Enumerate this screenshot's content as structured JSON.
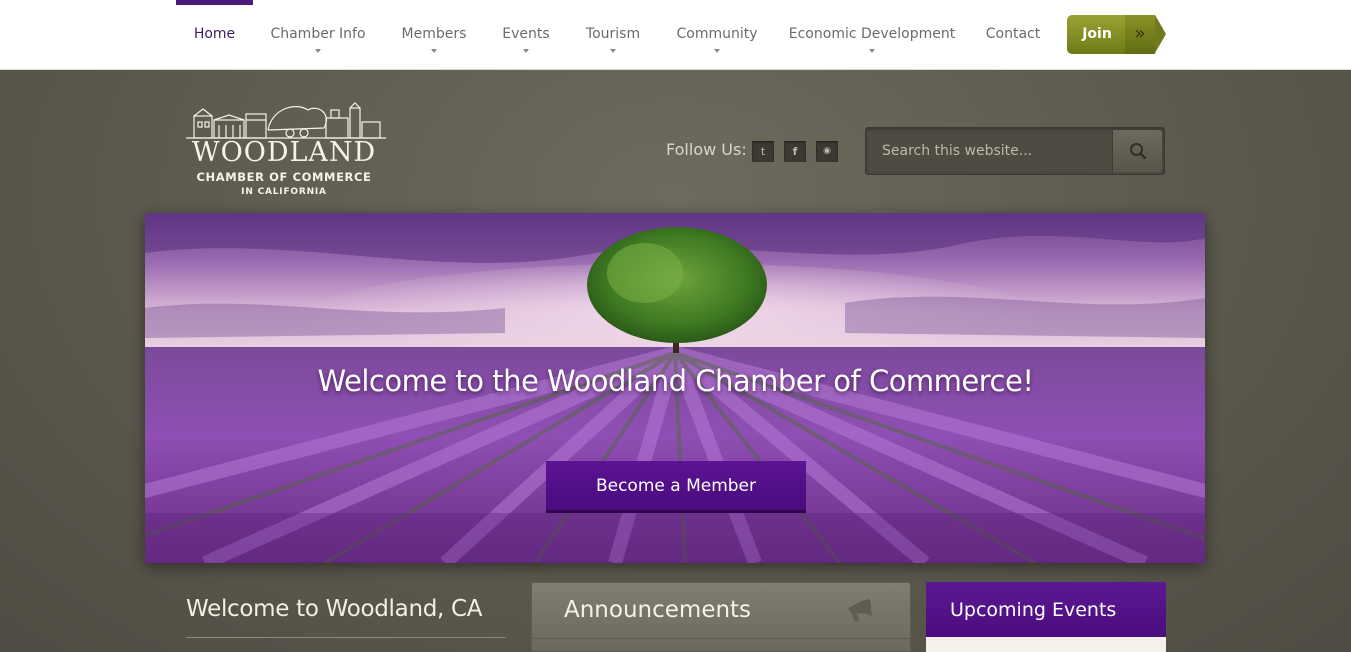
{
  "nav": {
    "items": [
      {
        "label": "Home",
        "active": true,
        "dropdown": false
      },
      {
        "label": "Chamber Info",
        "active": false,
        "dropdown": true
      },
      {
        "label": "Members",
        "active": false,
        "dropdown": true
      },
      {
        "label": "Events",
        "active": false,
        "dropdown": true
      },
      {
        "label": "Tourism",
        "active": false,
        "dropdown": true
      },
      {
        "label": "Community",
        "active": false,
        "dropdown": true
      },
      {
        "label": "Economic Development",
        "active": false,
        "dropdown": true
      },
      {
        "label": "Contact",
        "active": false,
        "dropdown": false
      }
    ],
    "join_label": "Join",
    "join_icon": "double-chevron-right-icon",
    "join_arrow": "»"
  },
  "logo": {
    "main": "WOODLAND",
    "sub": "CHAMBER OF COMMERCE",
    "sub2": "IN CALIFORNIA"
  },
  "follow": {
    "label": "Follow Us:",
    "icons": [
      {
        "name": "twitter-icon",
        "glyph": "t"
      },
      {
        "name": "facebook-icon",
        "glyph": "f"
      },
      {
        "name": "rss-icon",
        "glyph": "◉"
      }
    ]
  },
  "search": {
    "placeholder": "Search this website...",
    "icon": "search-icon"
  },
  "hero": {
    "title": "Welcome to the Woodland Chamber of Commerce!",
    "button": "Become a Member"
  },
  "sections": {
    "welcome_title": "Welcome to Woodland, CA",
    "announcements_title": "Announcements",
    "announcements_icon": "megaphone-icon",
    "events_title": "Upcoming Events"
  },
  "colors": {
    "accent_purple": "#4d1a7c",
    "join_green": "#7c8620",
    "page_bg": "#5c5a4e"
  }
}
